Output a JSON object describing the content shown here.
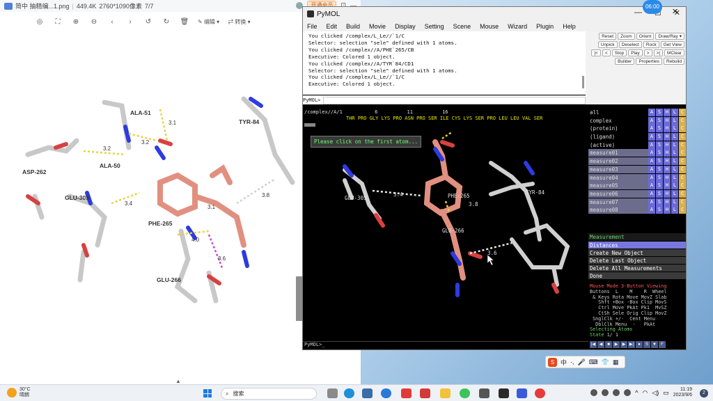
{
  "viewer": {
    "filename": "简中 抽精编...1.png",
    "filesize": "449.4K",
    "dimensions": "2760*1090像素",
    "page": "7/7",
    "vip_label": "开通会员",
    "edit_label": "编辑",
    "convert_label": "转换",
    "labels": {
      "ala51": "ALA-51",
      "tyr84": "TYR-84",
      "asp262": "ASP-262",
      "ala50": "ALA-50",
      "glu305": "GLU-305",
      "phe265": "PHE-265",
      "glu266": "GLU-266"
    },
    "distances": [
      "3.1",
      "3.2",
      "3.2",
      "3.4",
      "3.8",
      "3.1",
      "4.0",
      "3.6"
    ]
  },
  "pymol": {
    "title": "PyMOL",
    "menu": [
      "File",
      "Edit",
      "Build",
      "Movie",
      "Display",
      "Setting",
      "Scene",
      "Mouse",
      "Wizard",
      "Plugin",
      "Help"
    ],
    "log": [
      "You clicked /complex/L_Le//`1/C",
      "Selector: selection \"sele\" defined with 1 atoms.",
      "You clicked /complex//A/PHE`265/CB",
      "Executive: Colored 1 object.",
      "You clicked /complex//A/TYR`84/CD1",
      "Selector: selection \"sele\" defined with 1 atoms.",
      "You clicked /complex/L_Le//`1/C",
      "Executive: Colored 1 object."
    ],
    "cmd_prompt": "PyMOL>",
    "buttons_row1": [
      "Reset",
      "Zoom",
      "Orient",
      "Draw/Ray ▾"
    ],
    "buttons_row2": [
      "Unpick",
      "Deselect",
      "Rock",
      "Get View"
    ],
    "buttons_row3": [
      "|<",
      "<",
      "Stop",
      "Play",
      ">",
      ">|",
      "MClear"
    ],
    "buttons_row4": [
      "Builder",
      "Properties",
      "Rebuild"
    ],
    "sequence_header": "/complex//A/1           6          11          16",
    "sequence": "THR PRO GLY LYS PRO ASN PRO SER ILE CYS LYS SER PRO LEU LEU VAL SER",
    "viewport_prompt": "Please click on the first atom...",
    "scene_labels": [
      "GLU-305",
      "PHE-265",
      "TYR-84",
      "GLU-266"
    ],
    "scene_distances": [
      "3.4",
      "3.8",
      "3.6"
    ],
    "objects": [
      {
        "name": "all",
        "hl": false
      },
      {
        "name": "complex",
        "hl": false
      },
      {
        "name": "(protein)",
        "hl": false
      },
      {
        "name": "(ligand)",
        "hl": false
      },
      {
        "name": "(active)",
        "hl": false
      },
      {
        "name": "measure01",
        "hl": true
      },
      {
        "name": "measure02",
        "hl": true
      },
      {
        "name": "measure03",
        "hl": true
      },
      {
        "name": "measure04",
        "hl": true
      },
      {
        "name": "measure05",
        "hl": true
      },
      {
        "name": "measure06",
        "hl": true
      },
      {
        "name": "measure07",
        "hl": true
      },
      {
        "name": "measure08",
        "hl": true
      }
    ],
    "obj_buttons": [
      "A",
      "S",
      "H",
      "L",
      "C"
    ],
    "wizard": {
      "title": "Measurement",
      "items": [
        "Distances",
        "Create New Object",
        "Delete Last Object",
        "Delete All Measurements",
        "Done"
      ]
    },
    "mouse_mode": {
      "title": "Mouse Mode 3-Button Viewing",
      "lines": [
        "Buttons  L    M    R  Wheel",
        " & Keys Rota Move MovZ Slab",
        "   Shft +Box -Box Clip MovS",
        "   Ctrl Move PkAt Pk1  MvSZ",
        "   CtSh Sele Orig Clip MovZ",
        " SnglClk +/-  Cent Menu",
        "  DblClk Menu  -   PkAt"
      ],
      "selecting": "Selecting Atoms",
      "state_label": "State",
      "state_value": "1/   1"
    },
    "bottom_prompt": "PyMOL>_"
  },
  "clock_bubble": "06:00",
  "ime": {
    "lang": "中"
  },
  "taskbar": {
    "weather_temp": "30°C",
    "weather_desc": "晴朗",
    "search_placeholder": "搜索",
    "time": "11:19",
    "date": "2023/9/6",
    "notification_count": "2"
  }
}
